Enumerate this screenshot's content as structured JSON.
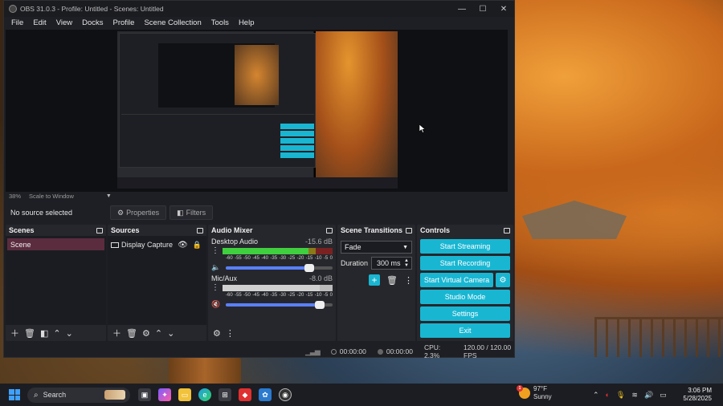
{
  "window": {
    "title": "OBS 31.0.3 - Profile: Untitled - Scenes: Untitled",
    "controls": [
      "—",
      "☐",
      "✕"
    ]
  },
  "menu": [
    "File",
    "Edit",
    "View",
    "Docks",
    "Profile",
    "Scene Collection",
    "Tools",
    "Help"
  ],
  "preview": {
    "zoom": "38%",
    "scale_mode": "Scale to Window"
  },
  "source_toolbar": {
    "no_source": "No source selected",
    "properties": "Properties",
    "filters": "Filters"
  },
  "scenes": {
    "title": "Scenes",
    "items": [
      "Scene"
    ]
  },
  "sources": {
    "title": "Sources",
    "items": [
      "Display Capture"
    ]
  },
  "audio_mixer": {
    "title": "Audio Mixer",
    "scale_labels": [
      "-60",
      "-55",
      "-50",
      "-45",
      "-40",
      "-35",
      "-30",
      "-25",
      "-20",
      "-15",
      "-10",
      "-5",
      "0"
    ],
    "channels": [
      {
        "name": "Desktop Audio",
        "db": "-15.6 dB",
        "level": 0.78,
        "volume": 0.78,
        "muted": false
      },
      {
        "name": "Mic/Aux",
        "db": "-8.0 dB",
        "level": 0.88,
        "volume": 0.88,
        "muted": true
      }
    ]
  },
  "scene_transitions": {
    "title": "Scene Transitions",
    "transition": "Fade",
    "duration_label": "Duration",
    "duration_value": "300 ms"
  },
  "controls": {
    "title": "Controls",
    "start_streaming": "Start Streaming",
    "start_recording": "Start Recording",
    "start_virtual_camera": "Start Virtual Camera",
    "studio_mode": "Studio Mode",
    "settings": "Settings",
    "exit": "Exit"
  },
  "status": {
    "stream_time": "00:00:00",
    "record_time": "00:00:00",
    "cpu": "CPU: 2.3%",
    "fps": "120.00 / 120.00 FPS"
  },
  "taskbar": {
    "search": "Search",
    "weather_temp": "97°F",
    "weather_desc": "Sunny",
    "weather_badge": "1",
    "time": "3:06 PM",
    "date": "5/28/2025"
  },
  "colors": {
    "accent": "#19b6d2",
    "scene_selected": "#5a2c3e",
    "muted": "#ff4040"
  }
}
